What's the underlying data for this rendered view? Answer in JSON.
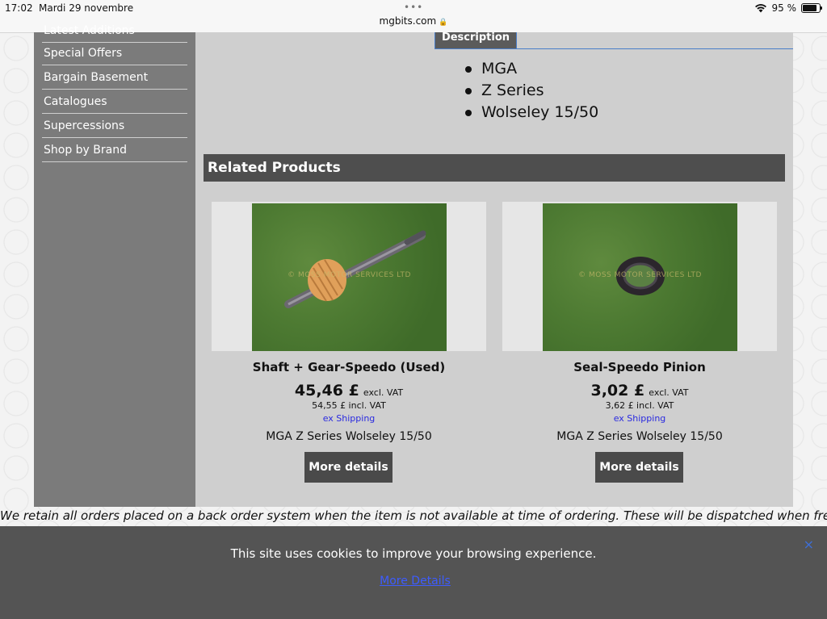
{
  "status_bar": {
    "time": "17:02",
    "date": "Mardi 29 novembre",
    "url": "mgbits.com",
    "battery": "95 %"
  },
  "sidebar": {
    "items": [
      {
        "label": "Latest Additions"
      },
      {
        "label": "Special Offers"
      },
      {
        "label": "Bargain Basement"
      },
      {
        "label": "Catalogues"
      },
      {
        "label": "Supercessions"
      },
      {
        "label": "Shop by Brand"
      }
    ]
  },
  "description": {
    "tab_label": "Description",
    "bullets": [
      "MGA",
      "Z Series",
      "Wolseley 15/50"
    ]
  },
  "related": {
    "heading": "Related Products",
    "products": [
      {
        "title": "Shaft + Gear-Speedo (Used)",
        "price": "45,46 £",
        "price_suffix": "excl. VAT",
        "price_incl": "54,55 £ incl. VAT",
        "shipping": "ex Shipping",
        "models": "MGA Z Series Wolseley 15/50",
        "button": "More details",
        "watermark": "© MOSS MOTOR SERVICES LTD"
      },
      {
        "title": "Seal-Speedo Pinion",
        "price": "3,02 £",
        "price_suffix": "excl. VAT",
        "price_incl": "3,62 £ incl. VAT",
        "shipping": "ex Shipping",
        "models": "MGA Z Series Wolseley 15/50",
        "button": "More details",
        "watermark": "© MOSS MOTOR SERVICES LTD"
      }
    ]
  },
  "notice": "We retain all orders placed on a back order system when the item is not available at time of ordering. These will be dispatched when fresh",
  "cookie": {
    "text": "This site uses cookies to improve your browsing experience.",
    "link": "More Details",
    "close": "×"
  },
  "colors": {
    "sidebar_bg": "#7b7b7b",
    "main_bg": "#cfcfcf",
    "heading_bar": "#4e4e4e",
    "link_blue": "#2a2ae0"
  }
}
